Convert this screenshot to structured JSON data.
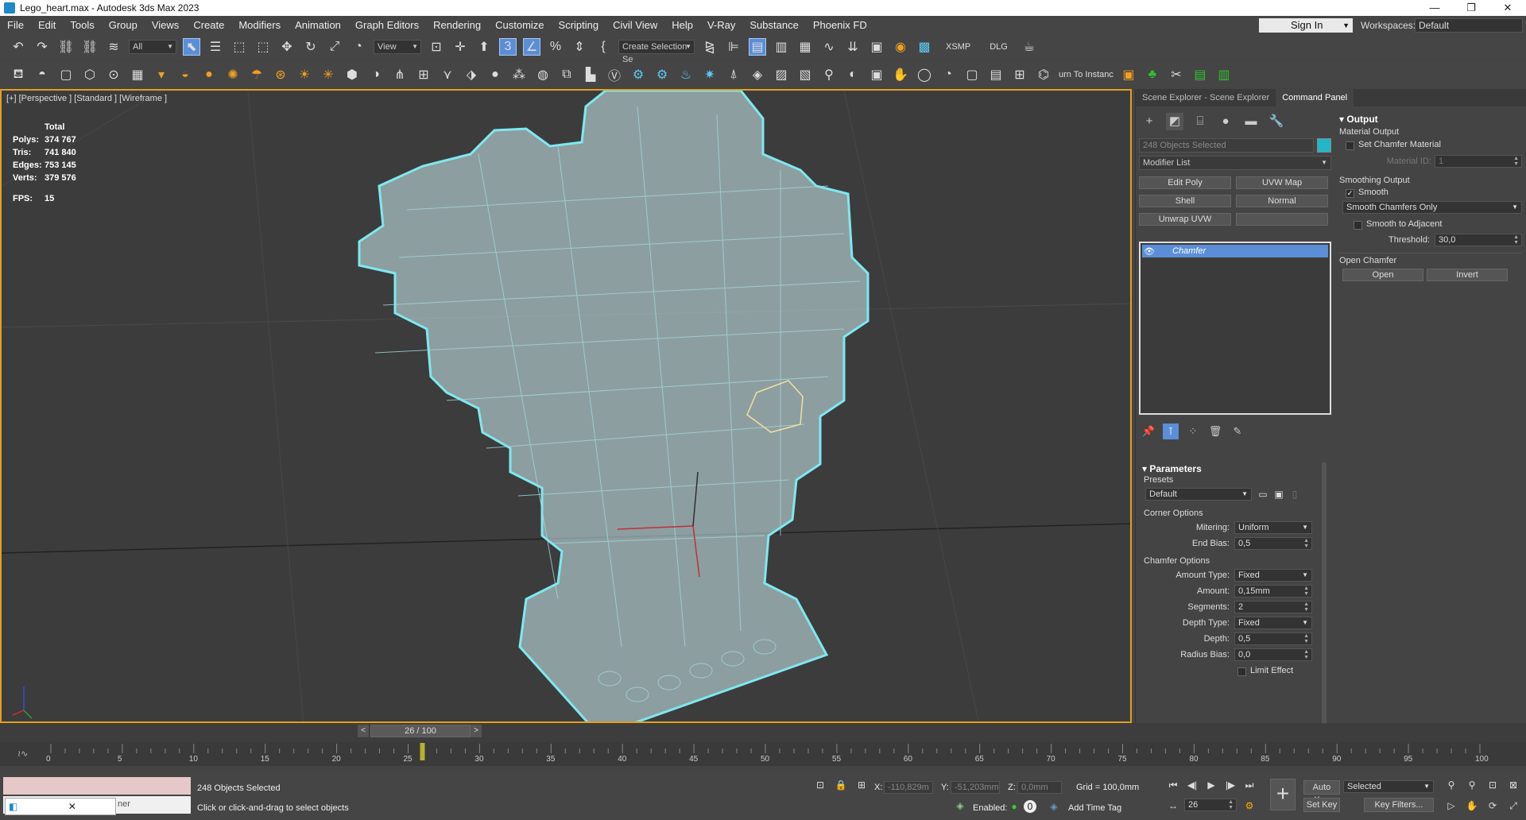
{
  "window": {
    "title": "Lego_heart.max - Autodesk 3ds Max 2023",
    "controls": [
      "—",
      "❐",
      "✕"
    ]
  },
  "menu": [
    "File",
    "Edit",
    "Tools",
    "Group",
    "Views",
    "Create",
    "Modifiers",
    "Animation",
    "Graph Editors",
    "Rendering",
    "Customize",
    "Scripting",
    "Civil View",
    "Help",
    "V-Ray",
    "Substance",
    "Phoenix FD"
  ],
  "signin": {
    "label": "Sign In"
  },
  "workspaces": {
    "label": "Workspaces:",
    "value": "Default"
  },
  "toolbar1": {
    "filter": "All",
    "ref_coord": "View",
    "selection_set": "Create Selection Se",
    "xsmp": "XSMP",
    "dlg": "DLG"
  },
  "toolbar2": {
    "instance_label": "urn To Instanc"
  },
  "viewport": {
    "label": "[+] [Perspective ] [Standard ] [Wireframe ]",
    "stats": {
      "title": "Total",
      "polys_label": "Polys:",
      "polys": "374 767",
      "tris_label": "Tris:",
      "tris": "741 840",
      "edges_label": "Edges:",
      "edges": "753 145",
      "verts_label": "Verts:",
      "verts": "379 576",
      "fps_label": "FPS:",
      "fps": "15"
    }
  },
  "panel": {
    "tabs": [
      "Scene Explorer - Scene Explorer",
      "Command Panel"
    ],
    "selection_name": "248 Objects Selected",
    "modifier_list": "Modifier List",
    "modifier_buttons": [
      "Edit Poly",
      "UVW Map",
      "Shell",
      "Normal",
      "Unwrap UVW",
      ""
    ],
    "stack_item": "Chamfer",
    "output": {
      "title": "Output",
      "material_output": "Material Output",
      "set_chamfer_material": "Set Chamfer Material",
      "material_id_label": "Material ID:",
      "material_id": "1",
      "smoothing_output": "Smoothing Output",
      "smooth": "Smooth",
      "smooth_mode": "Smooth Chamfers Only",
      "smooth_to_adjacent": "Smooth to Adjacent",
      "threshold_label": "Threshold:",
      "threshold": "30,0",
      "open_chamfer": "Open Chamfer",
      "open_btn": "Open",
      "invert_btn": "Invert"
    },
    "parameters": {
      "title": "Parameters",
      "presets_label": "Presets",
      "preset": "Default",
      "corner_options": "Corner Options",
      "mitering_label": "Mitering:",
      "mitering": "Uniform",
      "end_bias_label": "End Bias:",
      "end_bias": "0,5",
      "chamfer_options": "Chamfer Options",
      "amount_type_label": "Amount Type:",
      "amount_type": "Fixed",
      "amount_label": "Amount:",
      "amount": "0,15mm",
      "segments_label": "Segments:",
      "segments": "2",
      "depth_type_label": "Depth Type:",
      "depth_type": "Fixed",
      "depth_label": "Depth:",
      "depth": "0,5",
      "radius_bias_label": "Radius Bias:",
      "radius_bias": "0,0",
      "limit_effect": "Limit Effect"
    }
  },
  "timeline": {
    "frame_display": "26 / 100",
    "current_frame": 26,
    "total_frames": 100,
    "tick_labels": [
      "0",
      "5",
      "10",
      "15",
      "20",
      "25",
      "30",
      "35",
      "40",
      "45",
      "50",
      "55",
      "60",
      "65",
      "70",
      "75",
      "80",
      "85",
      "90",
      "95",
      "100"
    ]
  },
  "status": {
    "objects_selected": "248 Objects Selected",
    "prompt": "Click or click-and-drag to select objects",
    "x_label": "X:",
    "x": "-110,829m",
    "y_label": "Y:",
    "y": "-51,203mm",
    "z_label": "Z:",
    "z": "0,0mm",
    "grid": "Grid = 100,0mm",
    "enabled_label": "Enabled:",
    "add_time_tag": "Add Time Tag",
    "auto_key": "Auto Key",
    "selected": "Selected",
    "set_key": "Set Key",
    "key_filters": "Key Filters...",
    "frame": "26",
    "taskbar_text": "ner"
  }
}
